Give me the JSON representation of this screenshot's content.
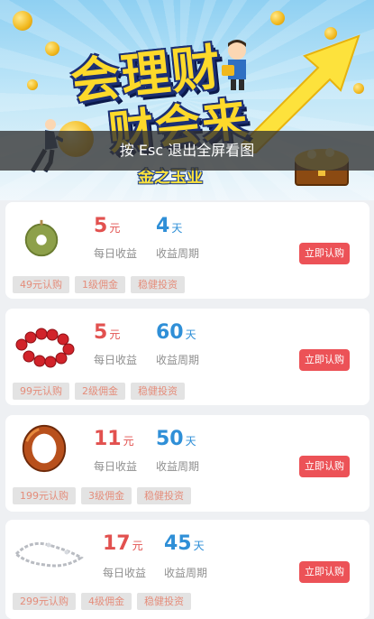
{
  "banner": {
    "title_line1": "会理财",
    "title_line2": "财会来",
    "brand": "金之玉业",
    "overlay_hint": "按 Esc 退出全屏看图"
  },
  "products": [
    {
      "name": "jade-pendant",
      "daily_yield": "5",
      "daily_unit": "元",
      "period": "4",
      "period_unit": "天",
      "daily_label": "每日收益",
      "period_label": "收益周期",
      "buy_label": "立即认购",
      "tags": [
        "49元认购",
        "1级佣金",
        "稳健投资"
      ]
    },
    {
      "name": "red-bead-bracelet",
      "daily_yield": "5",
      "daily_unit": "元",
      "period": "60",
      "period_unit": "天",
      "daily_label": "每日收益",
      "period_label": "收益周期",
      "buy_label": "立即认购",
      "tags": [
        "99元认购",
        "2级佣金",
        "稳健投资"
      ]
    },
    {
      "name": "agate-bangle",
      "daily_yield": "11",
      "daily_unit": "元",
      "period": "50",
      "period_unit": "天",
      "daily_label": "每日收益",
      "period_label": "收益周期",
      "buy_label": "立即认购",
      "tags": [
        "199元认购",
        "3级佣金",
        "稳健投资"
      ]
    },
    {
      "name": "silver-chain-bracelet",
      "daily_yield": "17",
      "daily_unit": "元",
      "period": "45",
      "period_unit": "天",
      "daily_label": "每日收益",
      "period_label": "收益周期",
      "buy_label": "立即认购",
      "tags": [
        "299元认购",
        "4级佣金",
        "稳健投资"
      ]
    }
  ],
  "colors": {
    "accent_red": "#e2514f",
    "accent_blue": "#2f8fd7",
    "button": "#ec5257",
    "tag_text": "#e48d7b"
  }
}
